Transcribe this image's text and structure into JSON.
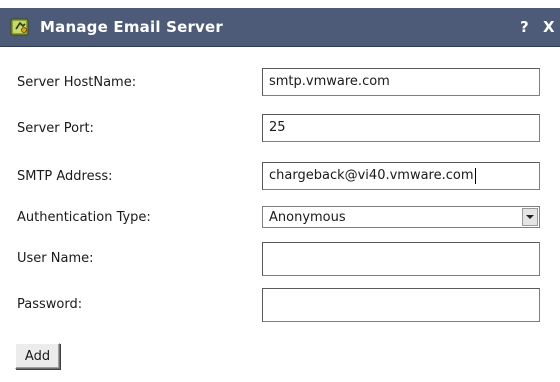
{
  "window": {
    "title": "Manage Email Server",
    "help_label": "?",
    "close_label": "X",
    "icon": "app-icon"
  },
  "form": {
    "server_hostname": {
      "label": "Server HostName:",
      "value": "smtp.vmware.com"
    },
    "server_port": {
      "label": "Server Port:",
      "value": "25"
    },
    "smtp_address": {
      "label": "SMTP Address:",
      "value": "chargeback@vi40.vmware.com"
    },
    "authentication_type": {
      "label": "Authentication Type:",
      "value": "Anonymous"
    },
    "user_name": {
      "label": "User Name:",
      "value": ""
    },
    "password": {
      "label": "Password:",
      "value": ""
    }
  },
  "buttons": {
    "add_label": "Add"
  },
  "colors": {
    "titlebar": "#4d5a78",
    "titlebar_text": "#ffffff"
  }
}
